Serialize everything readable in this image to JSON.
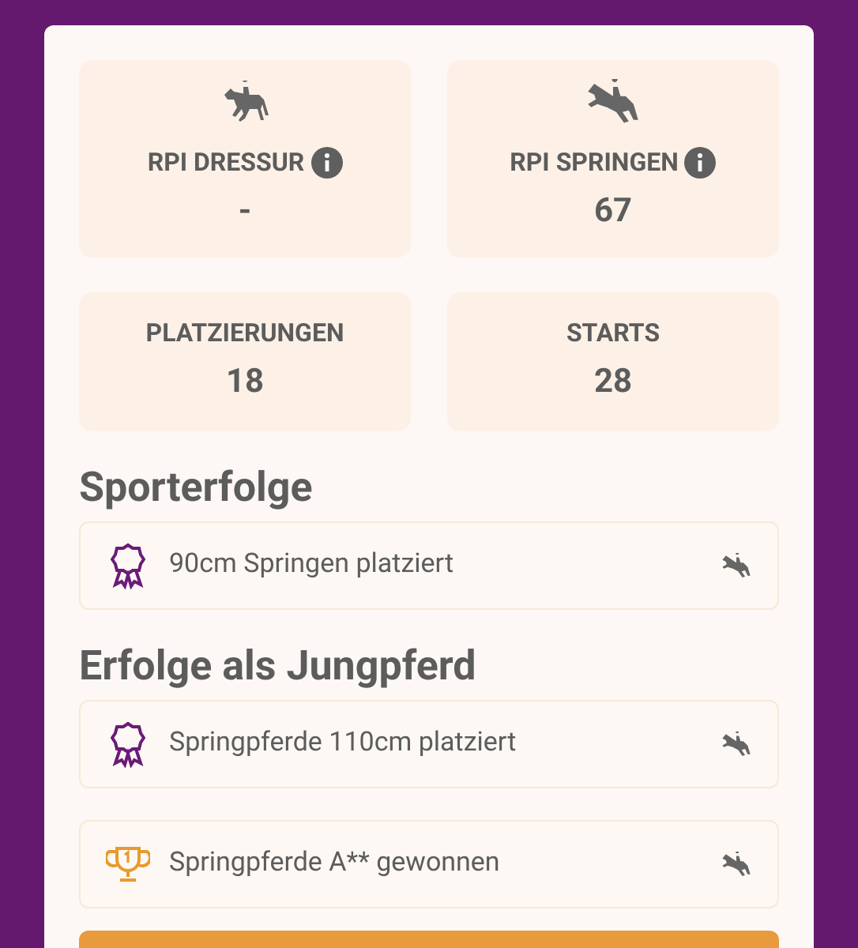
{
  "stats": [
    {
      "label": "RPI DRESSUR",
      "value": "-",
      "kind": "dressage",
      "info": true
    },
    {
      "label": "RPI SPRINGEN",
      "value": "67",
      "kind": "jumping",
      "info": true
    },
    {
      "label": "PLATZIERUNGEN",
      "value": "18",
      "kind": "plain",
      "info": false
    },
    {
      "label": "STARTS",
      "value": "28",
      "kind": "plain",
      "info": false
    }
  ],
  "sections": [
    {
      "title": "Sporterfolge",
      "items": [
        {
          "kind": "placed",
          "text": "90cm Springen platziert"
        }
      ]
    },
    {
      "title": "Erfolge als Jungpferd",
      "items": [
        {
          "kind": "placed",
          "text": "Springpferde 110cm platziert"
        },
        {
          "kind": "won",
          "text": "Springpferde A** gewonnen"
        }
      ]
    }
  ]
}
